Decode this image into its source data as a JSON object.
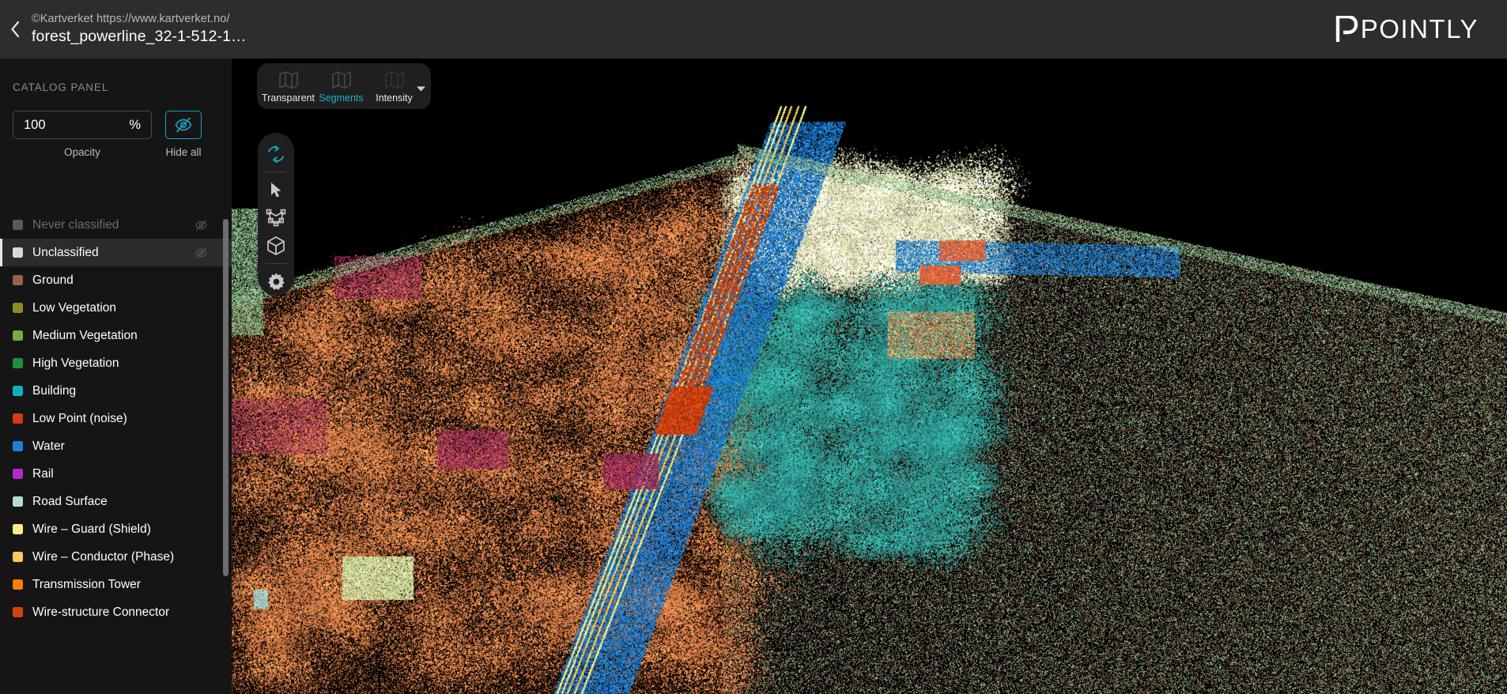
{
  "header": {
    "back_icon": "chevron-left-icon",
    "attribution": "©Kartverket https://www.kartverket.no/",
    "dataset_title": "forest_powerline_32-1-512-1…",
    "brand": "POINTLY"
  },
  "sidebar": {
    "panel_label": "CATALOG PANEL",
    "opacity": {
      "value": "100",
      "unit": "%",
      "caption": "Opacity"
    },
    "hide_all": {
      "caption": "Hide all",
      "icon": "eye-off-icon",
      "accent": "#17a2bd"
    },
    "classes": [
      {
        "label": "Never classified",
        "color": "#5a5a5a",
        "dim": true,
        "selected": false,
        "eye": "eye-off-icon"
      },
      {
        "label": "Unclassified",
        "color": "#d8d8d8",
        "dim": false,
        "selected": true,
        "eye": "eye-off-icon"
      },
      {
        "label": "Ground",
        "color": "#9a5f4e",
        "dim": false,
        "selected": false,
        "eye": null
      },
      {
        "label": "Low Vegetation",
        "color": "#8e8a27",
        "dim": false,
        "selected": false,
        "eye": null
      },
      {
        "label": "Medium Vegetation",
        "color": "#73ad3e",
        "dim": false,
        "selected": false,
        "eye": null
      },
      {
        "label": "High Vegetation",
        "color": "#1f8f3c",
        "dim": false,
        "selected": false,
        "eye": null
      },
      {
        "label": "Building",
        "color": "#10b0bd",
        "dim": false,
        "selected": false,
        "eye": null
      },
      {
        "label": "Low Point (noise)",
        "color": "#d43a14",
        "dim": false,
        "selected": false,
        "eye": null
      },
      {
        "label": "Water",
        "color": "#1e7fd4",
        "dim": false,
        "selected": false,
        "eye": null
      },
      {
        "label": "Rail",
        "color": "#b429cf",
        "dim": false,
        "selected": false,
        "eye": null
      },
      {
        "label": "Road Surface",
        "color": "#b3ded6",
        "dim": false,
        "selected": false,
        "eye": null
      },
      {
        "label": "Wire – Guard (Shield)",
        "color": "#fbeb87",
        "dim": false,
        "selected": false,
        "eye": null
      },
      {
        "label": "Wire – Conductor (Phase)",
        "color": "#fcc856",
        "dim": false,
        "selected": false,
        "eye": null
      },
      {
        "label": "Transmission Tower",
        "color": "#fb7b0b",
        "dim": false,
        "selected": false,
        "eye": null
      },
      {
        "label": "Wire-structure Connector",
        "color": "#d2430f",
        "dim": false,
        "selected": false,
        "eye": null
      }
    ]
  },
  "viewport": {
    "mode_bar": [
      {
        "label": "Transparent",
        "icon": "map-outline-icon",
        "active": false
      },
      {
        "label": "Segments",
        "icon": "map-outline-icon",
        "active": true
      },
      {
        "label": "Intensity",
        "icon": "map-dotted-icon",
        "active": false
      }
    ],
    "mode_caret": "chevron-down-icon",
    "tools": [
      {
        "name": "orbit-rotate-tool",
        "icon": "rotate-icon",
        "active": true
      },
      {
        "name": "select-tool",
        "icon": "cursor-arrow-icon",
        "active": false
      },
      {
        "name": "polygon-select-tool",
        "icon": "polygon-icon",
        "active": false
      },
      {
        "name": "box-select-tool",
        "icon": "cube-icon",
        "active": false
      },
      {
        "name": "settings-tool",
        "icon": "gear-icon",
        "active": false
      }
    ],
    "active_accent": "#17a2bd"
  }
}
